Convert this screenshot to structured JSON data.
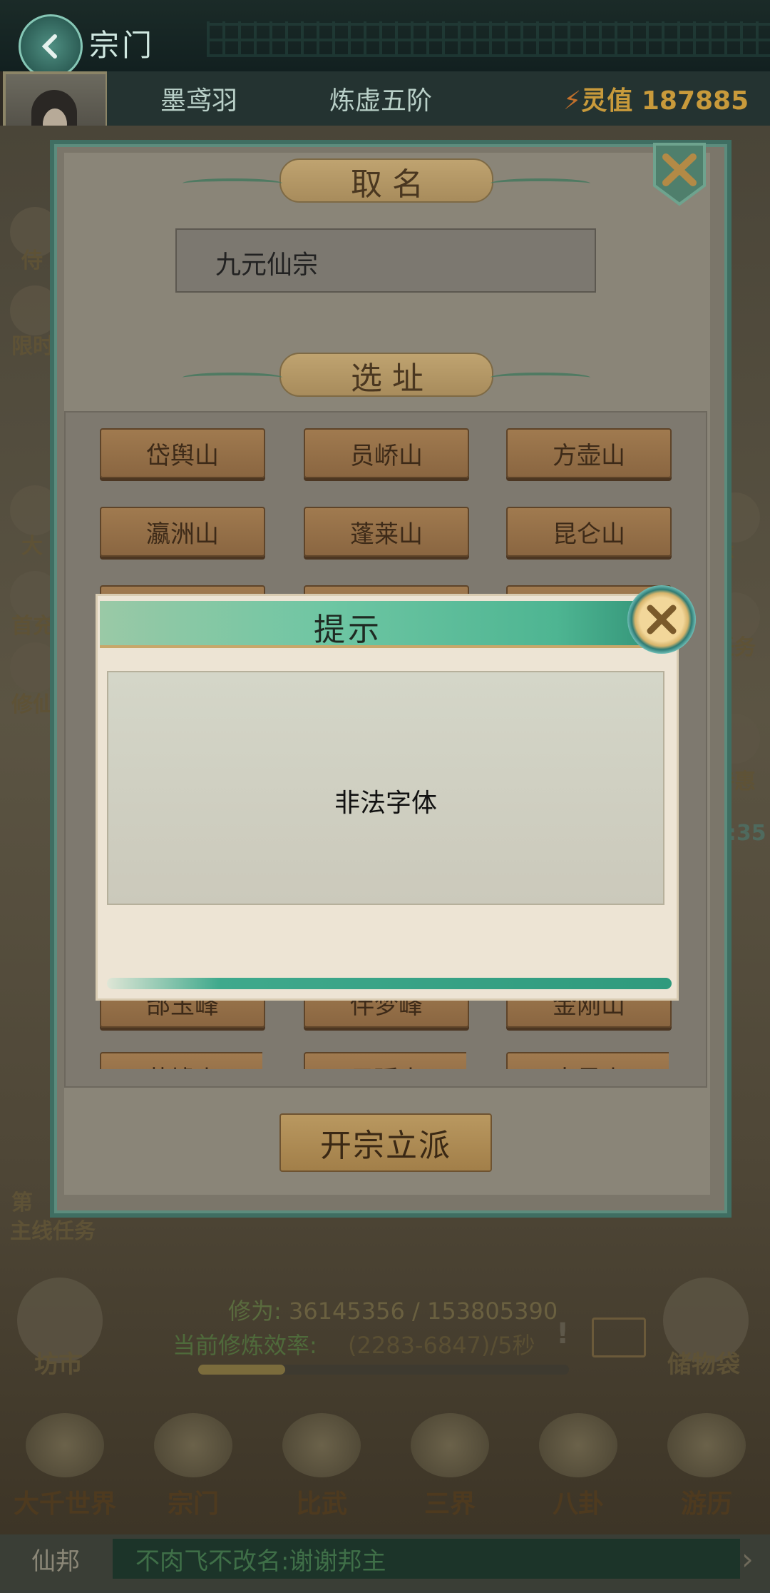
{
  "header": {
    "title": "宗门",
    "back_icon": "back-arrow-icon"
  },
  "player": {
    "name": "墨鸢羽",
    "rank": "炼虚五阶",
    "lingzhi_label": "灵值",
    "lingzhi_value": "187885"
  },
  "sidebar_left": [
    {
      "label": "侍"
    },
    {
      "label": "限时"
    },
    {
      "label": "大"
    },
    {
      "label": "首充"
    },
    {
      "label": "修仙"
    }
  ],
  "sidebar_right": [
    {
      "label": "缘"
    },
    {
      "label": "任务"
    },
    {
      "label": "特惠"
    },
    {
      "label": "4:35"
    }
  ],
  "dialog": {
    "name_header": "取名",
    "name_value": "九元仙宗",
    "address_header": "选址",
    "locations": [
      "岱舆山",
      "员峤山",
      "方壶山",
      "瀛洲山",
      "蓬莱山",
      "昆仑山",
      "",
      "",
      "",
      "",
      "",
      "",
      "",
      "",
      "",
      "邰玉峰",
      "伴梦峰",
      "金刚山",
      "茗墟山",
      "云瑶山",
      "大昊山"
    ],
    "found_button": "开宗立派"
  },
  "scene": {
    "stage_label": "第",
    "main_quest": "主线任务",
    "market": "坊市",
    "storage": "储物袋",
    "progress_label": "修为:",
    "progress_value": "36145356 / 153805390",
    "progress_fraction": 0.235,
    "efficiency_label": "当前修炼效率:",
    "efficiency_value": "(2283-6847)/5秒"
  },
  "nav": [
    {
      "label": "大千世界"
    },
    {
      "label": "宗门"
    },
    {
      "label": "比武"
    },
    {
      "label": "三界"
    },
    {
      "label": "八卦"
    },
    {
      "label": "游历"
    }
  ],
  "chat": {
    "channel": "仙邦",
    "message": "不肉飞不改名:谢谢邦主"
  },
  "modal": {
    "title": "提示",
    "message": "非法字体"
  }
}
